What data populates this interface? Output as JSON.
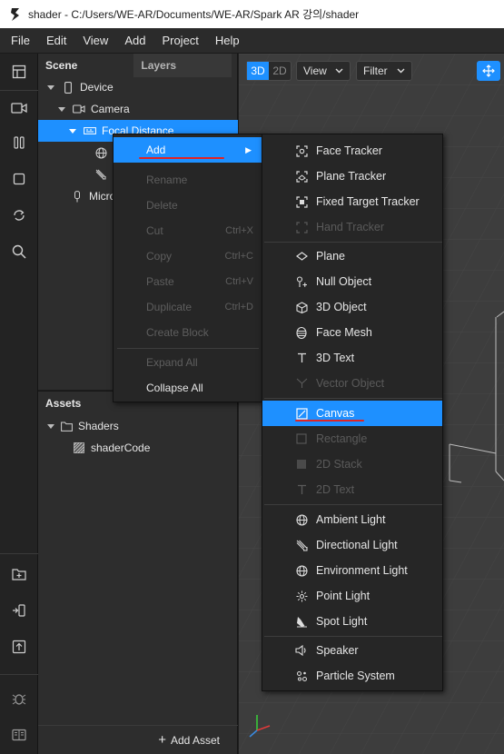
{
  "window": {
    "title": "shader - C:/Users/WE-AR/Documents/WE-AR/Spark AR 강의/shader"
  },
  "menu": [
    "File",
    "Edit",
    "View",
    "Add",
    "Project",
    "Help"
  ],
  "scene": {
    "tab_scene": "Scene",
    "tab_layers": "Layers",
    "tree": {
      "device": "Device",
      "camera": "Camera",
      "focal_distance": "Focal Distance",
      "microphone": "Micro"
    }
  },
  "assets": {
    "title": "Assets",
    "folder": "Shaders",
    "item": "shaderCode",
    "add_asset": "Add Asset"
  },
  "viewport": {
    "mode_3d": "3D",
    "mode_2d": "2D",
    "view_label": "View",
    "filter_label": "Filter"
  },
  "context_menu": {
    "add": "Add",
    "rename": "Rename",
    "delete": "Delete",
    "cut": "Cut",
    "cut_shortcut": "Ctrl+X",
    "copy": "Copy",
    "copy_shortcut": "Ctrl+C",
    "paste": "Paste",
    "paste_shortcut": "Ctrl+V",
    "duplicate": "Duplicate",
    "duplicate_shortcut": "Ctrl+D",
    "create_block": "Create Block",
    "expand_all": "Expand All",
    "collapse_all": "Collapse All"
  },
  "add_submenu": {
    "face_tracker": "Face Tracker",
    "plane_tracker": "Plane Tracker",
    "fixed_target_tracker": "Fixed Target Tracker",
    "hand_tracker": "Hand Tracker",
    "plane": "Plane",
    "null_object": "Null Object",
    "object_3d": "3D Object",
    "face_mesh": "Face Mesh",
    "text_3d": "3D Text",
    "vector_object": "Vector Object",
    "canvas": "Canvas",
    "rectangle": "Rectangle",
    "stack_2d": "2D Stack",
    "text_2d": "2D Text",
    "ambient_light": "Ambient Light",
    "directional_light": "Directional Light",
    "environment_light": "Environment Light",
    "point_light": "Point Light",
    "spot_light": "Spot Light",
    "speaker": "Speaker",
    "particle_system": "Particle System"
  },
  "colors": {
    "accent": "#1e90ff",
    "annotation": "#e02424"
  }
}
